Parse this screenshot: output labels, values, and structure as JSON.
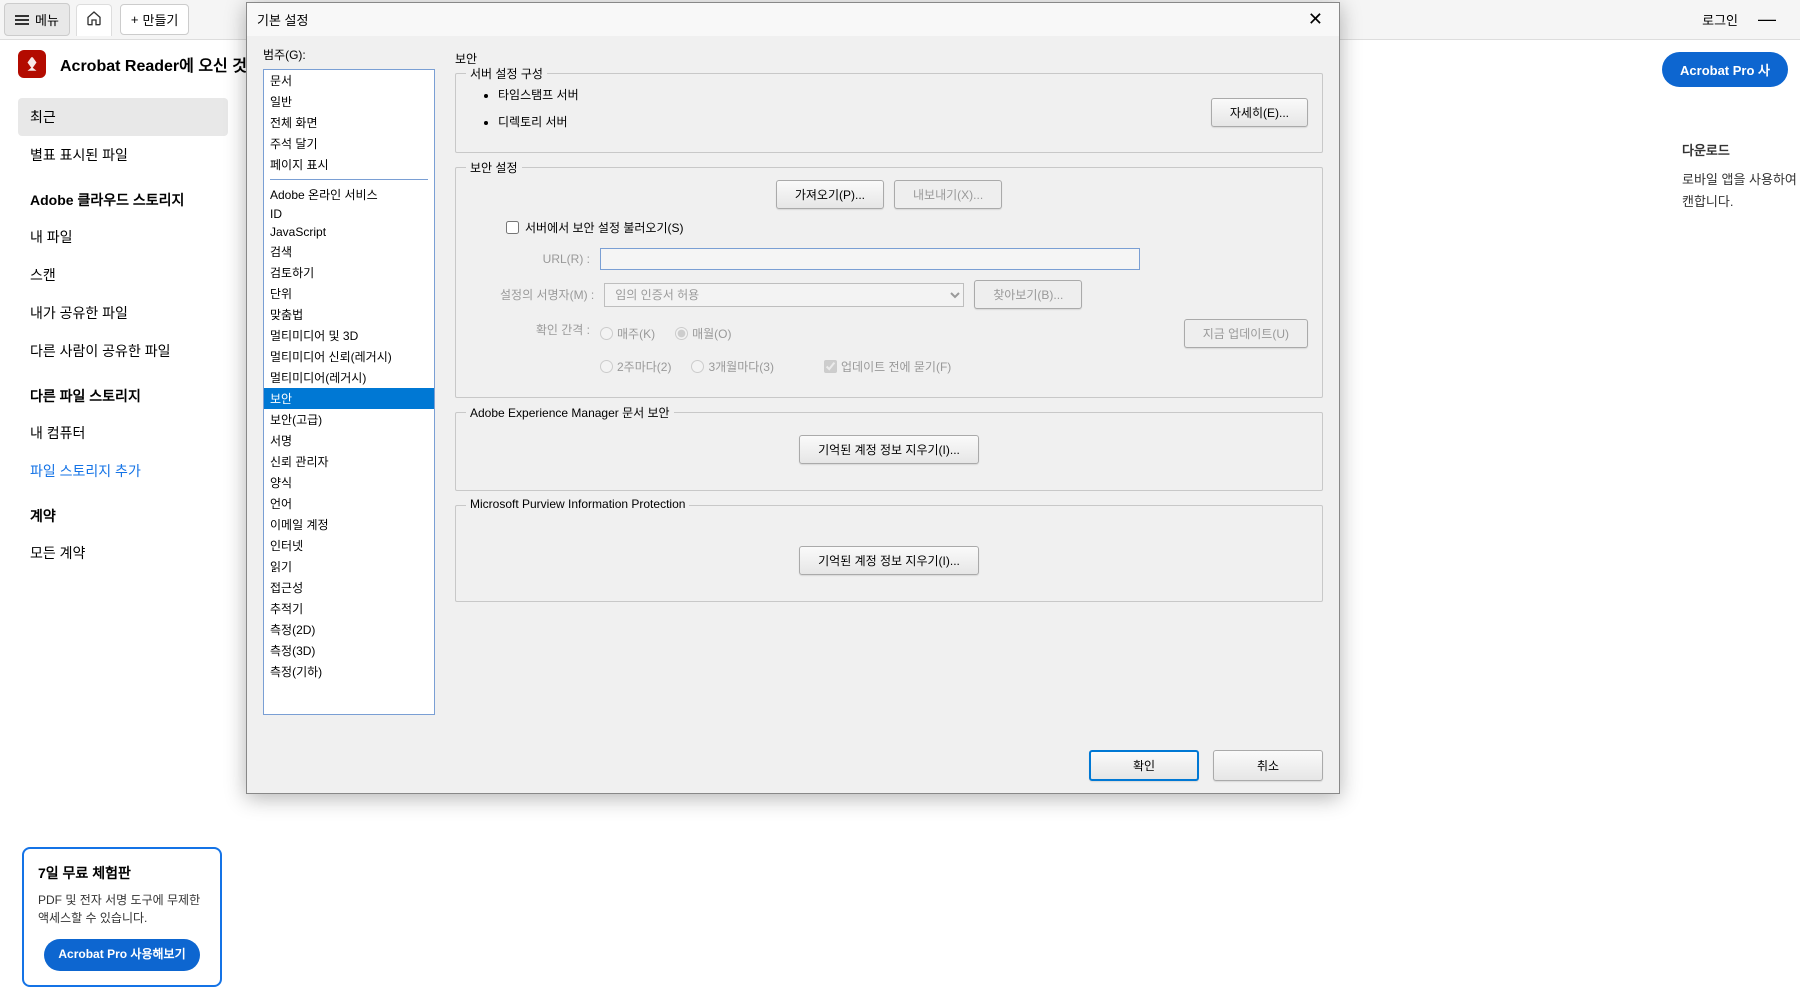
{
  "topbar": {
    "menu_label": "메뉴",
    "create_label": "만들기",
    "login_label": "로그인"
  },
  "welcome": {
    "text": "Acrobat Reader에 오신 것을"
  },
  "pro_button": "Acrobat Pro 사",
  "sidebar": {
    "recent": "최근",
    "starred": "별표 표시된 파일",
    "heading_cloud": "Adobe 클라우드 스토리지",
    "my_files": "내 파일",
    "scan": "스캔",
    "shared_by_me": "내가 공유한 파일",
    "shared_by_others": "다른 사람이 공유한 파일",
    "heading_other": "다른 파일 스토리지",
    "my_computer": "내 컴퓨터",
    "add_storage": "파일 스토리지 추가",
    "heading_contract": "계약",
    "all_contracts": "모든 계약"
  },
  "trial": {
    "title": "7일 무료 체험판",
    "desc": "PDF 및 전자 서명 도구에 무제한 액세스할 수 있습니다.",
    "button": "Acrobat Pro 사용해보기"
  },
  "prefs": {
    "title": "기본 설정",
    "category_label": "범주(G):",
    "categories_top": [
      "문서",
      "일반",
      "전체 화면",
      "주석 달기",
      "페이지 표시"
    ],
    "categories_bottom": [
      "Adobe 온라인 서비스",
      "ID",
      "JavaScript",
      "검색",
      "검토하기",
      "단위",
      "맞춤법",
      "멀티미디어 및 3D",
      "멀티미디어 신뢰(레거시)",
      "멀티미디어(레거시)",
      "보안",
      "보안(고급)",
      "서명",
      "신뢰 관리자",
      "양식",
      "언어",
      "이메일 계정",
      "인터넷",
      "읽기",
      "접근성",
      "추적기",
      "측정(2D)",
      "측정(3D)",
      "측정(기하)"
    ],
    "selected_category": "보안",
    "right_title": "보안",
    "server_config": {
      "legend": "서버 설정 구성",
      "timestamp": "타임스탬프 서버",
      "directory": "디렉토리 서버",
      "details_btn": "자세히(E)..."
    },
    "security_settings": {
      "legend": "보안 설정",
      "import_btn": "가져오기(P)...",
      "export_btn": "내보내기(X)...",
      "load_from_server": "서버에서 보안 설정 불러오기(S)",
      "url_label": "URL(R) :",
      "signer_label": "설정의 서명자(M) :",
      "signer_value": "임의 인증서 허용",
      "browse_btn": "찾아보기(B)...",
      "interval_label": "확인 간격 :",
      "opt_weekly": "매주(K)",
      "opt_monthly": "매월(O)",
      "opt_biweekly": "2주마다(2)",
      "opt_quarterly": "3개월마다(3)",
      "ask_before": "업데이트 전에 묻기(F)",
      "update_now": "지금 업데이트(U)"
    },
    "aem": {
      "legend": "Adobe Experience Manager 문서 보안",
      "clear_btn": "기억된 계정 정보 지우기(I)..."
    },
    "mpip": {
      "legend": "Microsoft Purview Information Protection",
      "clear_btn": "기억된 계정 정보 지우기(I)..."
    },
    "ok_btn": "확인",
    "cancel_btn": "취소"
  },
  "right_panel": {
    "heading": "다운로드",
    "line1": "로바일 앱을 사용하여",
    "line2": "캔합니다."
  }
}
